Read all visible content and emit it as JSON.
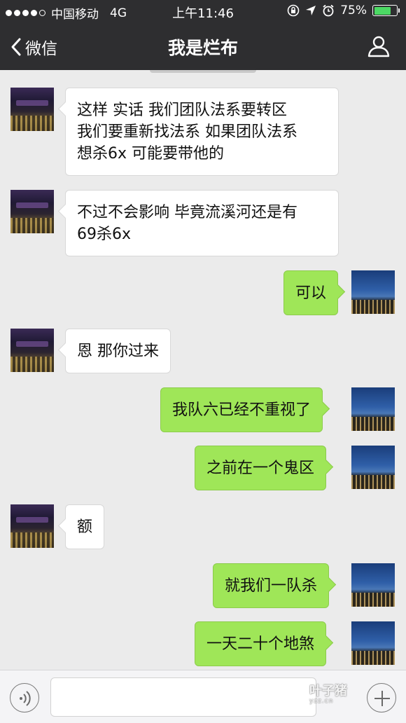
{
  "status_bar": {
    "carrier": "中国移动",
    "network": "4G",
    "time": "上午11:46",
    "battery_percent": "75%",
    "battery_level": 0.75
  },
  "nav": {
    "back_label": "微信",
    "title": "我是烂布",
    "back_icon": "chevron-left-icon",
    "profile_icon": "person-icon"
  },
  "messages": [
    {
      "side": "left",
      "lines": [
        "这样 实话 我们团队法系要转区",
        "我们要重新找法系 如果团队法系",
        "想杀6x 可能要带他的"
      ]
    },
    {
      "side": "left",
      "lines": [
        "不过不会影响 毕竟流溪河还是有",
        "69杀6x"
      ]
    },
    {
      "side": "right",
      "lines": [
        "可以"
      ]
    },
    {
      "side": "left",
      "lines": [
        "恩 那你过来"
      ]
    },
    {
      "side": "right",
      "lines": [
        "我队六已经不重视了"
      ]
    },
    {
      "side": "right",
      "lines": [
        "之前在一个鬼区"
      ]
    },
    {
      "side": "left",
      "lines": [
        "额"
      ]
    },
    {
      "side": "right",
      "lines": [
        "就我们一队杀"
      ]
    },
    {
      "side": "right",
      "lines": [
        "一天二十个地煞"
      ]
    }
  ],
  "input_bar": {
    "voice_icon": "voice-icon",
    "text_value": "",
    "plus_icon": "plus-icon"
  },
  "watermark": {
    "text": "叶子猪",
    "subtext": "yzz.cn"
  },
  "colors": {
    "header_bg": "#2e2e30",
    "chat_bg": "#ebebeb",
    "bubble_self": "#9fe658",
    "bubble_other": "#ffffff",
    "battery_fill": "#4cd964"
  }
}
